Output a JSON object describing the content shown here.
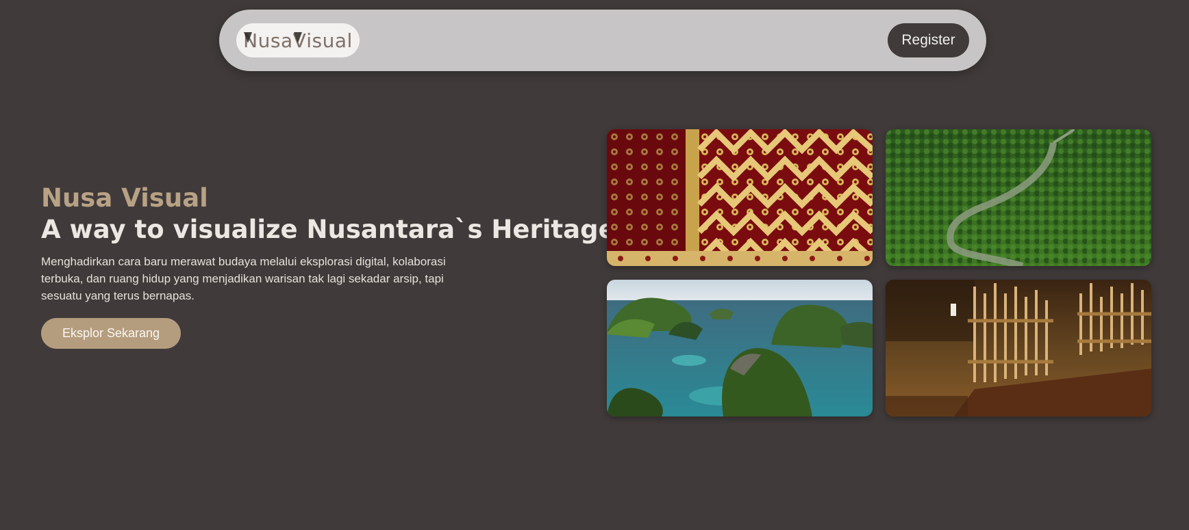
{
  "navbar": {
    "logo_text": "NusaVisual",
    "logo_first": "N",
    "logo_mid": "usa",
    "logo_v": "V",
    "logo_end": "isual",
    "register_label": "Register"
  },
  "hero": {
    "brand": "Nusa Visual",
    "title": "A way to visualize Nusantara`s Heritage",
    "description": "Menghadirkan cara baru merawat budaya melalui eksplorasi digital, kolaborasi terbuka, dan ruang hidup yang menjadikan warisan tak lagi sekadar arsip, tapi sesuatu yang terus bernapas.",
    "cta_label": "Eksplor Sekarang"
  },
  "gallery": [
    {
      "subject": "songket-textile"
    },
    {
      "subject": "rainforest-river"
    },
    {
      "subject": "raja-ampat-islands"
    },
    {
      "subject": "angklung-instruments"
    }
  ],
  "colors": {
    "background": "#403a3a",
    "navbar": "#c7c5c5",
    "accent": "#b8a285",
    "button_dark": "#403a3a"
  }
}
